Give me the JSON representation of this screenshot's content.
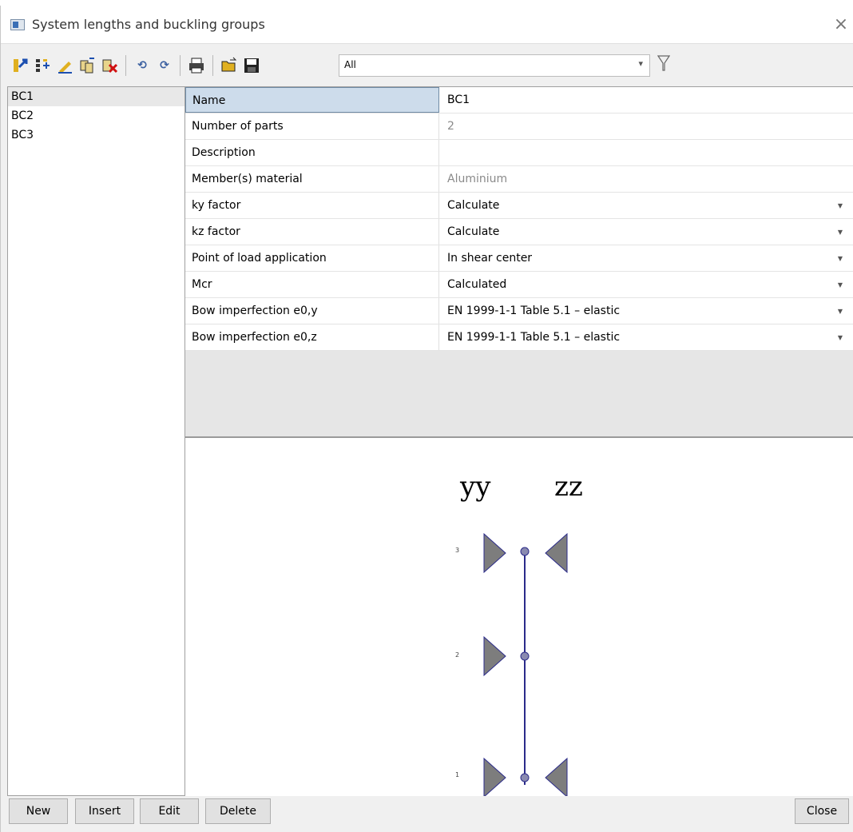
{
  "window": {
    "title": "System lengths and buckling groups"
  },
  "toolbar": {
    "filter_value": "All",
    "icons": [
      "new-record-icon",
      "reorder-icon",
      "edit-icon",
      "copy-icon",
      "delete-icon",
      "undo-icon",
      "redo-icon",
      "print-icon",
      "open-icon",
      "save-icon",
      "filter-icon"
    ]
  },
  "list": {
    "items": [
      "BC1",
      "BC2",
      "BC3"
    ],
    "selected": "BC1"
  },
  "properties": {
    "rows": [
      {
        "name": "Name",
        "value": "BC1",
        "readonly": false,
        "dropdown": false
      },
      {
        "name": "Number of parts",
        "value": "2",
        "readonly": true,
        "dropdown": false
      },
      {
        "name": "Description",
        "value": "",
        "readonly": false,
        "dropdown": false
      },
      {
        "name": "Member(s) material",
        "value": "Aluminium",
        "readonly": true,
        "dropdown": false
      },
      {
        "name": "ky factor",
        "value": "Calculate",
        "readonly": false,
        "dropdown": true
      },
      {
        "name": "kz factor",
        "value": "Calculate",
        "readonly": false,
        "dropdown": true
      },
      {
        "name": "Point of load application",
        "value": "In shear center",
        "readonly": false,
        "dropdown": true
      },
      {
        "name": "Mcr",
        "value": "Calculated",
        "readonly": false,
        "dropdown": true
      },
      {
        "name": "Bow imperfection e0,y",
        "value": "EN 1999-1-1 Table 5.1 – elastic",
        "readonly": false,
        "dropdown": true
      },
      {
        "name": "Bow imperfection e0,z",
        "value": "EN 1999-1-1 Table 5.1 – elastic",
        "readonly": false,
        "dropdown": true
      }
    ]
  },
  "drawing": {
    "yy_label": "yy",
    "zz_label": "zz",
    "nodes": [
      {
        "label": "3",
        "yy_support": true,
        "zz_support": true
      },
      {
        "label": "2",
        "yy_support": true,
        "zz_support": false
      },
      {
        "label": "1",
        "yy_support": true,
        "zz_support": true
      }
    ]
  },
  "buttons": {
    "new": "New",
    "insert": "Insert",
    "edit": "Edit",
    "delete": "Delete",
    "close": "Close"
  },
  "colors": {
    "support_fill": "#7d7d7d",
    "support_stroke": "#2b2b8a",
    "member": "#2b2b8a",
    "node_fill": "#8a8ab0",
    "selected_row": "#cddceb"
  }
}
